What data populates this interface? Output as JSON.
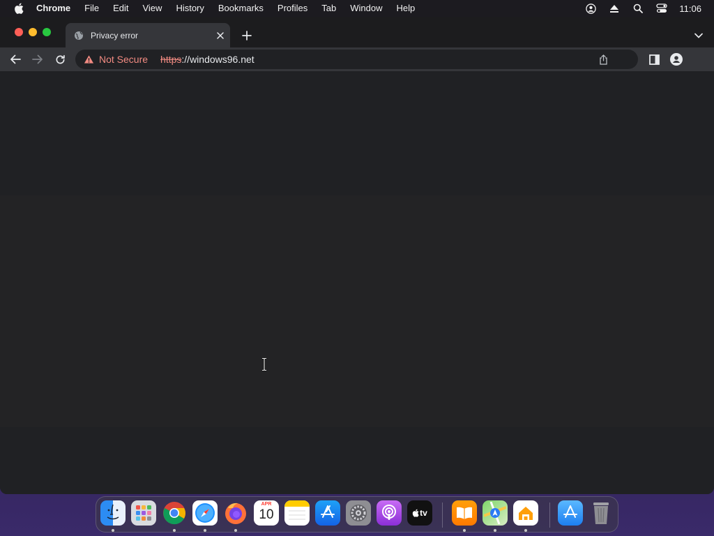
{
  "menubar": {
    "app_name": "Chrome",
    "items": [
      "File",
      "Edit",
      "View",
      "History",
      "Bookmarks",
      "Profiles",
      "Tab",
      "Window",
      "Help"
    ],
    "clock": "11:06"
  },
  "tab": {
    "title": "Privacy error"
  },
  "omnibox": {
    "security_label": "Not Secure",
    "scheme": "https",
    "host": "://windows96.net"
  },
  "dock": {
    "calendar_month": "APR",
    "calendar_day": "10",
    "tv_label": "tv"
  },
  "colors": {
    "warning": "#f28b82",
    "tab_active": "#35363a",
    "page_bg": "#202124"
  }
}
